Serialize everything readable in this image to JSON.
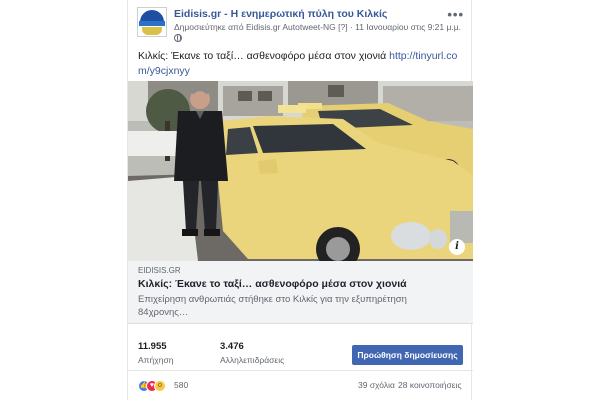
{
  "header": {
    "page_name": "Eidisis.gr - Η ενημερωτική πύλη του Κιλκίς",
    "published_by_prefix": "Δημοσιεύτηκε από",
    "publisher": "Eidisis.gr Autotweet-NG",
    "publisher_suffix": "[?]",
    "timestamp": "11 Ιανουαρίου στις 9:21 μ.μ.",
    "privacy_icon": "globe-icon",
    "more_icon": "more-options-icon",
    "more_label": "•••"
  },
  "post": {
    "text": "Κιλκίς: Έκανε το ταξί… ασθενοφόρο μέσα στον χιονιά",
    "link": "http://tinyurl.com/y9cjxnyy"
  },
  "photo": {
    "info_label": "i"
  },
  "link_card": {
    "domain": "EIDISIS.GR",
    "title": "Κιλκίς: Έκανε το ταξί… ασθενοφόρο μέσα στον χιονιά",
    "description": "Επιχείρηση ανθρωπιάς στήθηκε στο Κιλκίς για την εξυπηρέτηση 84χρονης…"
  },
  "stats": {
    "reach_value": "11.955",
    "reach_label": "Απήχηση",
    "engagement_value": "3.476",
    "engagement_label": "Αλληλεπιδράσεις",
    "boost_label": "Προώθηση δημοσίευσης"
  },
  "reactions": {
    "icons": [
      "like-icon",
      "love-icon",
      "wow-icon"
    ],
    "count": "580",
    "comments": "39 σχόλια",
    "shares": "28 κοινοποιήσεις"
  },
  "colors": {
    "accent": "#4267b2",
    "link": "#385898",
    "taxi_yellow": "#ead57c"
  }
}
